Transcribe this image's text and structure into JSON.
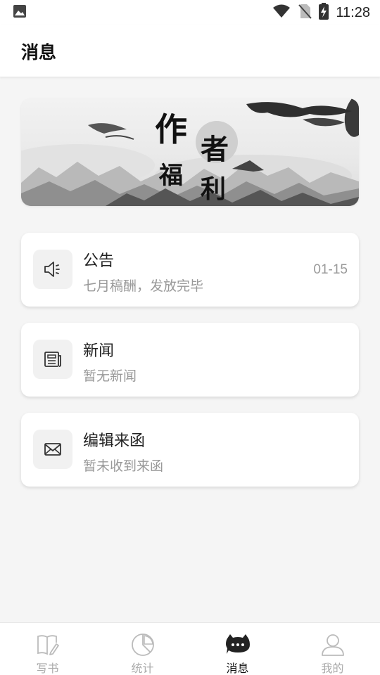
{
  "status_bar": {
    "time": "11:28"
  },
  "header": {
    "title": "消息"
  },
  "banner": {
    "art_chars": [
      "作",
      "者",
      "福",
      "利"
    ]
  },
  "messages": [
    {
      "title": "公告",
      "subtitle": "七月稿酬，发放完毕",
      "date": "01-15",
      "icon": "megaphone-icon"
    },
    {
      "title": "新闻",
      "subtitle": "暂无新闻",
      "icon": "newspaper-icon"
    },
    {
      "title": "编辑来函",
      "subtitle": "暂未收到来函",
      "icon": "envelope-icon"
    }
  ],
  "tabbar": {
    "tabs": [
      {
        "label": "写书",
        "icon": "write-book-icon",
        "active": false
      },
      {
        "label": "统计",
        "icon": "pie-chart-icon",
        "active": false
      },
      {
        "label": "消息",
        "icon": "message-bubble-icon",
        "active": true
      },
      {
        "label": "我的",
        "icon": "user-icon",
        "active": false
      }
    ]
  },
  "colors": {
    "accent": "#111111",
    "inactive": "#aaaaaa",
    "subtext": "#999999"
  }
}
